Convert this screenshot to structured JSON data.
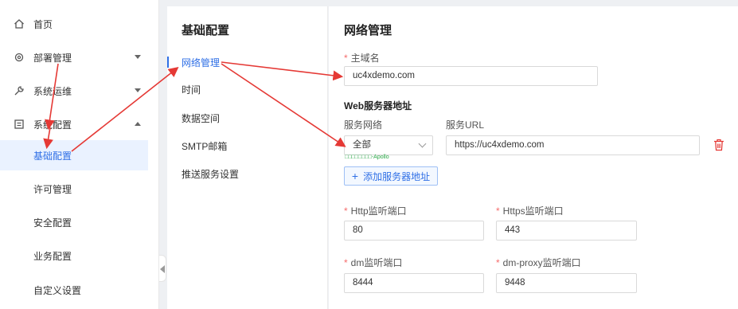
{
  "sidebar": {
    "items": [
      {
        "label": "首页",
        "icon": "home-icon"
      },
      {
        "label": "部署管理",
        "icon": "gear-icon"
      },
      {
        "label": "系统运维",
        "icon": "wrench-icon"
      },
      {
        "label": "系统配置",
        "icon": "settings-panel-icon"
      }
    ],
    "sub_items": [
      {
        "label": "基础配置"
      },
      {
        "label": "许可管理"
      },
      {
        "label": "安全配置"
      },
      {
        "label": "业务配置"
      },
      {
        "label": "自定义设置"
      }
    ]
  },
  "middle": {
    "title": "基础配置",
    "items": [
      {
        "label": "网络管理"
      },
      {
        "label": "时间"
      },
      {
        "label": "数据空间"
      },
      {
        "label": "SMTP邮箱"
      },
      {
        "label": "推送服务设置"
      }
    ]
  },
  "main": {
    "title": "网络管理",
    "domain_label": "主域名",
    "domain_value": "uc4xdemo.com",
    "web_section": "Web服务器地址",
    "service_network_label": "服务网络",
    "service_url_label": "服务URL",
    "service_network_value": "全部",
    "service_url_value": "https://uc4xdemo.com",
    "select_hint": "□□□□□□□□-Apollo",
    "add_button": "添加服务器地址",
    "http_label": "Http监听端口",
    "http_value": "80",
    "https_label": "Https监听端口",
    "https_value": "443",
    "dm_label": "dm监听端口",
    "dm_value": "8444",
    "dmproxy_label": "dm-proxy监听端口",
    "dmproxy_value": "9448"
  },
  "colors": {
    "accent": "#2f6fe6",
    "required": "#f56c6c",
    "arrow": "#e53935"
  }
}
